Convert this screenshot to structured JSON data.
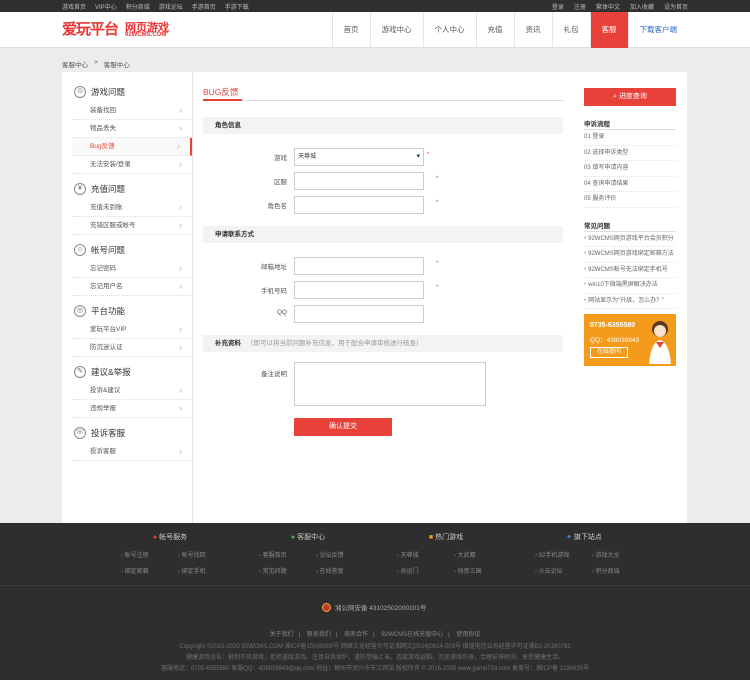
{
  "topbar": {
    "left": [
      "游戏首页",
      "VIP中心",
      "积分商城",
      "游戏论坛",
      "手游首页",
      "手游下载"
    ],
    "right": [
      "登录",
      "注册",
      "繁体中文",
      "加入收藏",
      "设为首页"
    ]
  },
  "logo": {
    "brand": "爱玩平台",
    "sub": "网页游戏",
    "domain": "92WCMS.COM"
  },
  "nav": [
    "首页",
    "游戏中心",
    "个人中心",
    "充值",
    "资讯",
    "礼包",
    "客服",
    "下载客户端"
  ],
  "crumb": [
    "客服中心",
    ">",
    "客服中心"
  ],
  "sidebar": [
    {
      "title": "游戏问题",
      "icon": "gamepad-icon",
      "items": [
        "装备找回",
        "物品丢失",
        "Bug反馈",
        "无法安装/登录"
      ]
    },
    {
      "title": "充值问题",
      "icon": "yen-icon",
      "items": [
        "充值未到账",
        "充错区服或帐号"
      ]
    },
    {
      "title": "帐号问题",
      "icon": "user-icon",
      "items": [
        "忘记密码",
        "忘记用户名"
      ]
    },
    {
      "title": "平台功能",
      "icon": "platform-icon",
      "items": [
        "爱玩平台VIP",
        "防沉迷认证"
      ]
    },
    {
      "title": "建议&举报",
      "icon": "pen-icon",
      "items": [
        "投诉&建议",
        "违规举报"
      ]
    },
    {
      "title": "投诉客服",
      "icon": "headset-icon",
      "items": [
        "投诉客服"
      ]
    }
  ],
  "form": {
    "title": "BUG反馈",
    "sec1": "角色信息",
    "game_label": "游戏",
    "game_value": "天尊城",
    "server_label": "区服",
    "role_label": "角色名",
    "sec2": "申请联系方式",
    "email_label": "邮箱地址",
    "phone_label": "手机号码",
    "qq_label": "QQ",
    "sec3": "补充资料",
    "sec3_note": "（即可以将当前问题补充信息，用于配合申请审核进行核查）",
    "remark_label": "备注说明",
    "submit": "确认提交"
  },
  "right": {
    "query_btn": "进度查询",
    "steps_title": "申诉流程",
    "steps": [
      "01 登录",
      "02 选择申诉类型",
      "03 填写申请内容",
      "04 查询申请结果",
      "05 服务评价"
    ],
    "faq_title": "常见问题",
    "faq": [
      "92WCMS网页游戏平台会员积分",
      "92WCMS网页游戏绑定邮箱方法",
      "92WCMS帐号无法绑定手机号",
      "win10下微端黑屏解决办法",
      "网站显示为“升级，怎么办？”"
    ],
    "ad_phone": "0735-6355580",
    "ad_qq": "QQ：438039943",
    "ad_btn": "在线提问"
  },
  "footer": {
    "cols": [
      {
        "title": "帐号服务",
        "icon": "person-icon",
        "links": [
          "帐号注册",
          "帐号找回",
          "绑定邮箱",
          "绑定手机"
        ]
      },
      {
        "title": "客服中心",
        "icon": "chat-icon",
        "links": [
          "客服首页",
          "论坛反馈",
          "常见问题",
          "在线答复"
        ]
      },
      {
        "title": "热门游戏",
        "icon": "game-icon",
        "links": [
          "天尊城",
          "大武都",
          "命运门",
          "快意三国"
        ]
      },
      {
        "title": "旗下站点",
        "icon": "site-icon",
        "links": [
          "92手机游戏",
          "游戏大全",
          "火云论坛",
          "积分商城"
        ]
      }
    ],
    "gov": "湘公网安备 43102502000101号",
    "links": [
      "关于我们",
      "联系我们",
      "商务合作",
      "92WCMS在线充值中心",
      "使用协议"
    ],
    "line1": "Copyright ©2015-2020 92WCMS.COM  湘ICP备15000000号  网络文化经营许可证湘网文[2016]0814-003号  增值电信业务经营许可证湘B2-20160791",
    "line2": "健康游戏忠告：抵制不良游戏，拒绝盗版游戏。注意自我保护，谨防受骗上当。适度游戏益脑，沉迷游戏伤身。合理安排时间，享受健康生活。",
    "line3": "客服电话：0735-6355580 客服QQ：438039943@qq.com 地址：郴州市资兴市东江宾馆 版权所有 © 2016-2020 www.game719.com 备案号：湘ICP备 1296825号"
  }
}
